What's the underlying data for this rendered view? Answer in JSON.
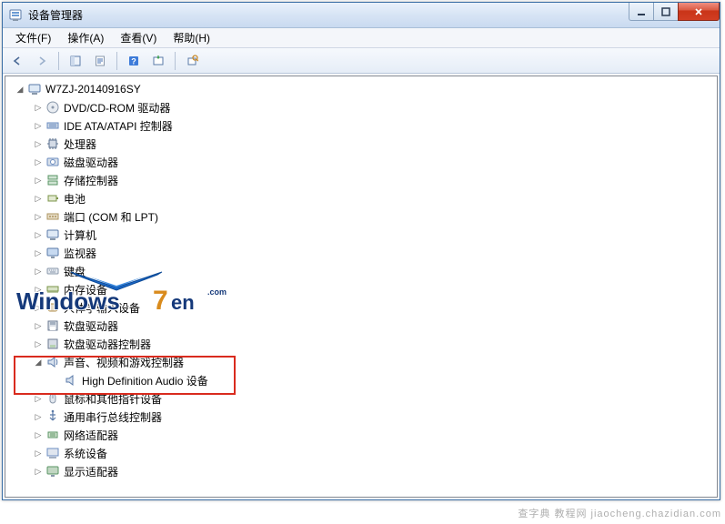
{
  "window": {
    "title": "设备管理器"
  },
  "menus": {
    "file": "文件(F)",
    "action": "操作(A)",
    "view": "查看(V)",
    "help": "帮助(H)"
  },
  "tree": {
    "root": "W7ZJ-20140916SY",
    "items": [
      {
        "label": "DVD/CD-ROM 驱动器",
        "icon": "disc"
      },
      {
        "label": "IDE ATA/ATAPI 控制器",
        "icon": "ide"
      },
      {
        "label": "处理器",
        "icon": "cpu"
      },
      {
        "label": "磁盘驱动器",
        "icon": "disk"
      },
      {
        "label": "存储控制器",
        "icon": "storage"
      },
      {
        "label": "电池",
        "icon": "battery"
      },
      {
        "label": "端口 (COM 和 LPT)",
        "icon": "port"
      },
      {
        "label": "计算机",
        "icon": "computer"
      },
      {
        "label": "监视器",
        "icon": "monitor"
      },
      {
        "label": "键盘",
        "icon": "keyboard"
      },
      {
        "label": "内存设备",
        "icon": "memory"
      },
      {
        "label": "人体学输入设备",
        "icon": "hid"
      },
      {
        "label": "软盘驱动器",
        "icon": "floppy"
      },
      {
        "label": "软盘驱动器控制器",
        "icon": "floppyctrl"
      },
      {
        "label": "声音、视频和游戏控制器",
        "icon": "sound",
        "expanded": true,
        "children": [
          {
            "label": "High Definition Audio 设备",
            "icon": "speaker"
          }
        ]
      },
      {
        "label": "鼠标和其他指针设备",
        "icon": "mouse"
      },
      {
        "label": "通用串行总线控制器",
        "icon": "usb"
      },
      {
        "label": "网络适配器",
        "icon": "network"
      },
      {
        "label": "系统设备",
        "icon": "system"
      },
      {
        "label": "显示适配器",
        "icon": "display"
      }
    ]
  },
  "watermark_bottom": "查字典 教程网  jiaocheng.chazidian.com"
}
